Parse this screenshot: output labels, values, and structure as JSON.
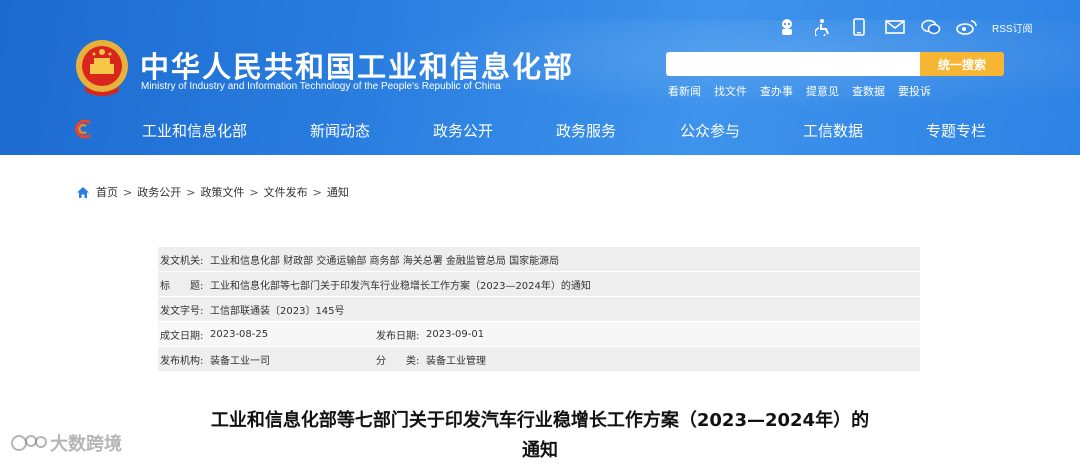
{
  "header": {
    "site_title": "中华人民共和国工业和信息化部",
    "site_subtitle": "Ministry of Industry and Information Technology of the People's Republic of China",
    "utility_icons": [
      "robot-icon",
      "accessibility-icon",
      "mobile-icon",
      "mail-icon",
      "wechat-icon",
      "weibo-icon"
    ],
    "rss_label": "RSS订阅",
    "search_placeholder": "",
    "search_button": "统一搜索",
    "quick_links": [
      "看新闻",
      "找文件",
      "查办事",
      "提意见",
      "查数据",
      "要投诉"
    ],
    "nav": [
      "工业和信息化部",
      "新闻动态",
      "政务公开",
      "政务服务",
      "公众参与",
      "工信数据",
      "专题专栏"
    ],
    "brand_color": "#2a7ee0",
    "search_button_color": "#f7b534"
  },
  "breadcrumb": [
    "首页",
    "政务公开",
    "政策文件",
    "文件发布",
    "通知"
  ],
  "info": {
    "issuer_label": "发文机关:",
    "issuer_value": "工业和信息化部 财政部 交通运输部 商务部 海关总署 金融监管总局 国家能源局",
    "title_label": "标　　题:",
    "title_value": "工业和信息化部等七部门关于印发汽车行业稳增长工作方案（2023—2024年）的通知",
    "doc_no_label": "发文字号:",
    "doc_no_value": "工信部联通装〔2023〕145号",
    "created_label": "成文日期:",
    "created_value": "2023-08-25",
    "published_label": "发布日期:",
    "published_value": "2023-09-01",
    "org_label": "发布机构:",
    "org_value": "装备工业一司",
    "category_label": "分　　类:",
    "category_value": "装备工业管理"
  },
  "doc_title_line1": "工业和信息化部等七部门关于印发汽车行业稳增长工作方案（2023—2024年）的",
  "doc_title_line2": "通知",
  "watermark": "大数跨境"
}
